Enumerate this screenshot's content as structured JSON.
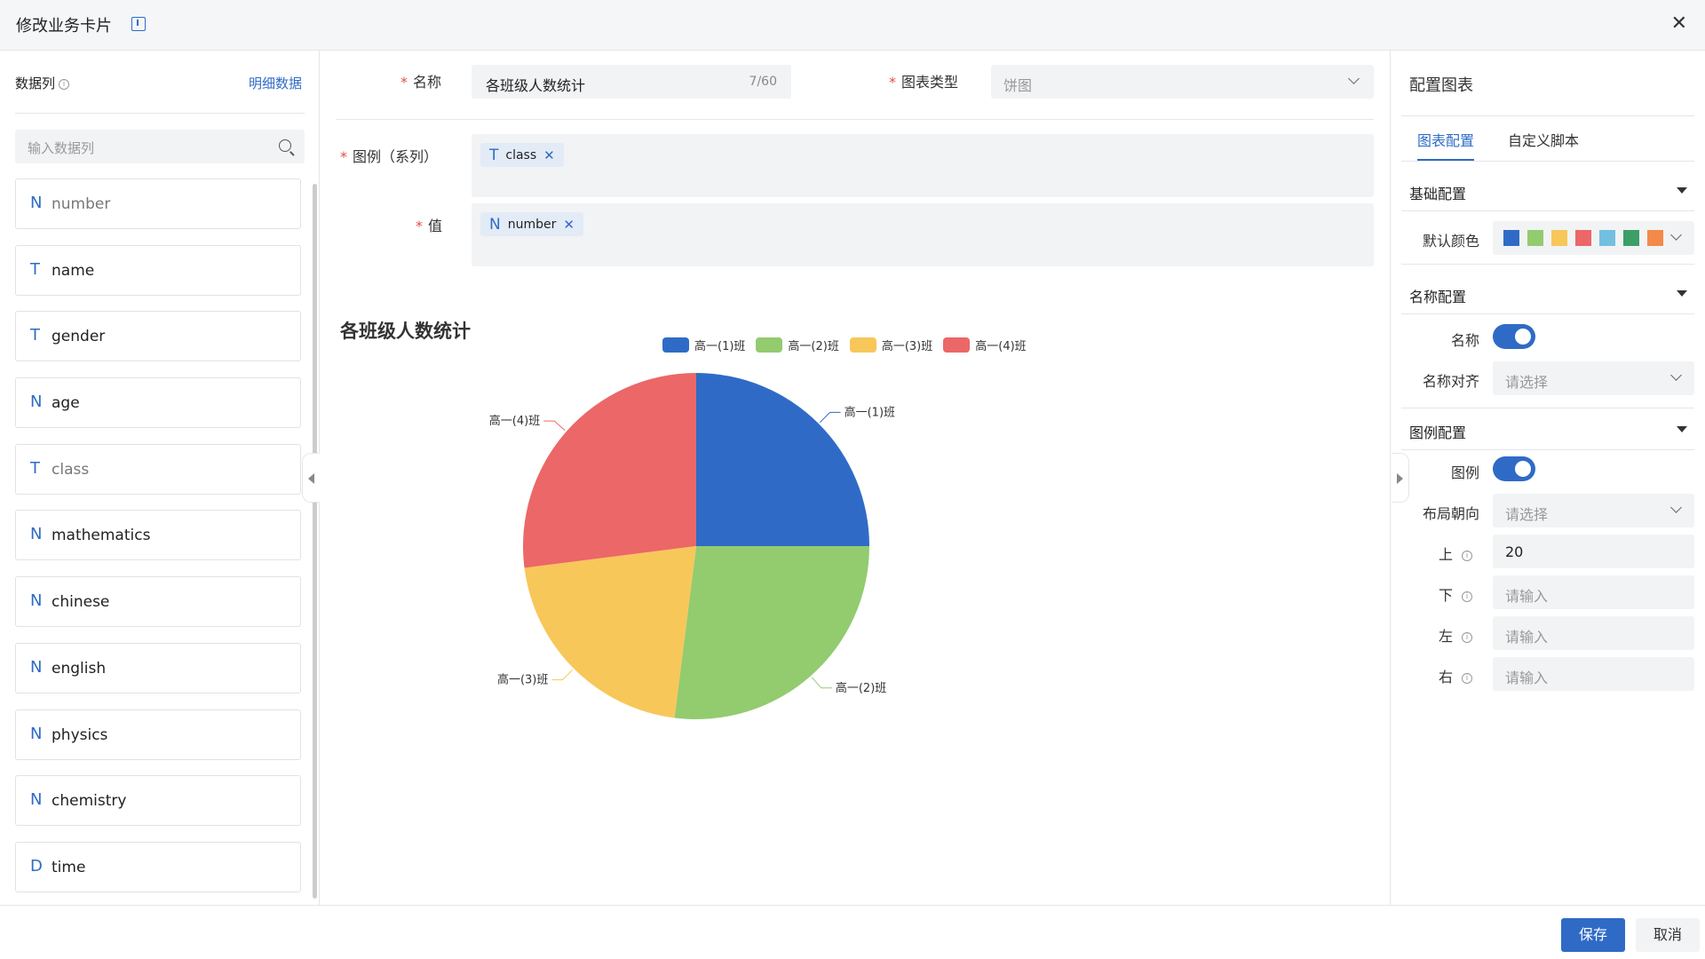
{
  "header": {
    "title": "修改业务卡片"
  },
  "left": {
    "title": "数据列",
    "detail_link": "明细数据",
    "search_placeholder": "输入数据列",
    "columns": [
      {
        "type": "N",
        "name": "number"
      },
      {
        "type": "T",
        "name": "name"
      },
      {
        "type": "T",
        "name": "gender"
      },
      {
        "type": "N",
        "name": "age"
      },
      {
        "type": "T",
        "name": "class"
      },
      {
        "type": "N",
        "name": "mathematics"
      },
      {
        "type": "N",
        "name": "chinese"
      },
      {
        "type": "N",
        "name": "english"
      },
      {
        "type": "N",
        "name": "physics"
      },
      {
        "type": "N",
        "name": "chemistry"
      },
      {
        "type": "D",
        "name": "time"
      }
    ]
  },
  "form": {
    "name_label": "名称",
    "name_value": "各班级人数统计",
    "name_counter": "7/60",
    "type_label": "图表类型",
    "type_value": "饼图",
    "legend_label": "图例（系列）",
    "legend_tag": {
      "type": "T",
      "name": "class"
    },
    "value_label": "值",
    "value_tag": {
      "type": "N",
      "name": "number"
    }
  },
  "chart_data": {
    "type": "pie",
    "title": "各班级人数统计",
    "categories": [
      "高一(1)班",
      "高一(2)班",
      "高一(3)班",
      "高一(4)班"
    ],
    "values": [
      25,
      27,
      21,
      27
    ],
    "colors": [
      "#2f6bc6",
      "#93cb6f",
      "#f8c75a",
      "#ec6767"
    ],
    "legend_position": "top-center"
  },
  "right": {
    "title": "配置图表",
    "tabs": [
      "图表配置",
      "自定义脚本"
    ],
    "basic_section": "基础配置",
    "default_color_label": "默认颜色",
    "palette": [
      "#2f6bc6",
      "#93cb6f",
      "#f8c75a",
      "#ec6767",
      "#73bfe0",
      "#3c9f67",
      "#f38a4a"
    ],
    "name_section": "名称配置",
    "name_toggle_label": "名称",
    "name_align_label": "名称对齐",
    "select_placeholder": "请选择",
    "legend_section": "图例配置",
    "legend_toggle_label": "图例",
    "layout_label": "布局朝向",
    "top_label": "上",
    "top_value": "20",
    "bottom_label": "下",
    "left_label": "左",
    "right_label": "右",
    "input_placeholder": "请输入"
  },
  "footer": {
    "save": "保存",
    "cancel": "取消"
  }
}
